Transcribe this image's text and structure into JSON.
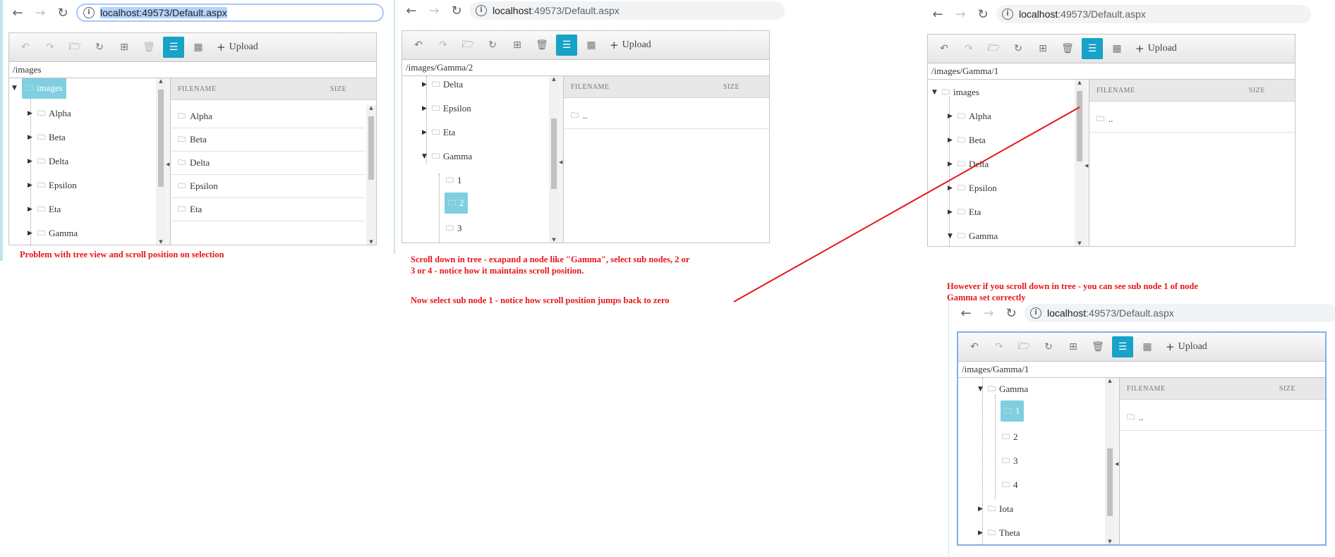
{
  "colors": {
    "annotation": "#e8151b",
    "selection": "#7fcfe0",
    "active_tool": "#17a2c8"
  },
  "browser": {
    "host": "localhost",
    "path": ":49573/Default.aspx",
    "full_url": "localhost:49573/Default.aspx"
  },
  "toolbar": {
    "upload_label": "Upload",
    "icons": [
      "undo-icon",
      "redo-icon",
      "open-folder-icon",
      "refresh-icon",
      "new-folder-icon",
      "delete-icon",
      "list-view-icon",
      "grid-view-icon"
    ]
  },
  "grid": {
    "col_filename": "FILENAME",
    "col_size": "SIZE",
    "parent_dir": ".."
  },
  "panel1": {
    "path": "/images",
    "tree": {
      "root": "images",
      "children": [
        "Alpha",
        "Beta",
        "Delta",
        "Epsilon",
        "Eta",
        "Gamma"
      ]
    },
    "files": [
      "Alpha",
      "Beta",
      "Delta",
      "Epsilon",
      "Eta"
    ]
  },
  "panel2": {
    "path": "/images/Gamma/2",
    "tree": {
      "items": [
        "Delta",
        "Epsilon",
        "Eta",
        "Gamma"
      ],
      "gamma_children": [
        "1",
        "2",
        "3"
      ]
    }
  },
  "panel3": {
    "path": "/images/Gamma/1",
    "tree": {
      "root": "images",
      "children": [
        "Alpha",
        "Beta",
        "Delta",
        "Epsilon",
        "Eta",
        "Gamma"
      ]
    }
  },
  "panel4": {
    "path": "/images/Gamma/1",
    "tree": {
      "gamma": "Gamma",
      "gamma_children": [
        "1",
        "2",
        "3",
        "4"
      ],
      "after": [
        "Iota",
        "Theta"
      ]
    }
  },
  "annotations": {
    "a1": "Problem with tree view and scroll position on selection",
    "a2_line1": "Scroll down in tree - exapand a node like \"Gamma\",  select sub nodes, 2 or",
    "a2_line2": "3 or 4 - notice how it maintains scroll position.",
    "a3": "Now select sub node 1 - notice how scroll position jumps back to zero",
    "a4_line1": "However if you scroll down in tree - you can see sub node 1 of node",
    "a4_line2": "Gamma set correctly"
  }
}
